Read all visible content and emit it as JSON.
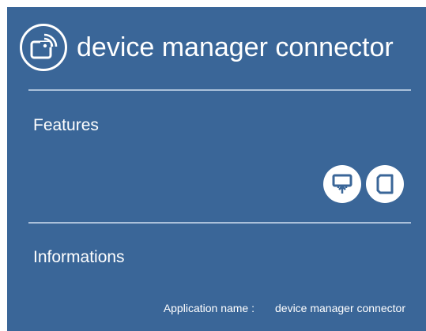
{
  "header": {
    "title": "device manager connector",
    "logo_icon": "device-signal-icon"
  },
  "features": {
    "title": "Features",
    "icons": [
      "screen-upload-icon",
      "tablet-icon"
    ]
  },
  "informations": {
    "title": "Informations",
    "application_name_label": "Application name :",
    "application_name_value": "device manager connector"
  },
  "colors": {
    "background": "#3a6698",
    "divider": "#aac0da",
    "text": "#ffffff"
  }
}
